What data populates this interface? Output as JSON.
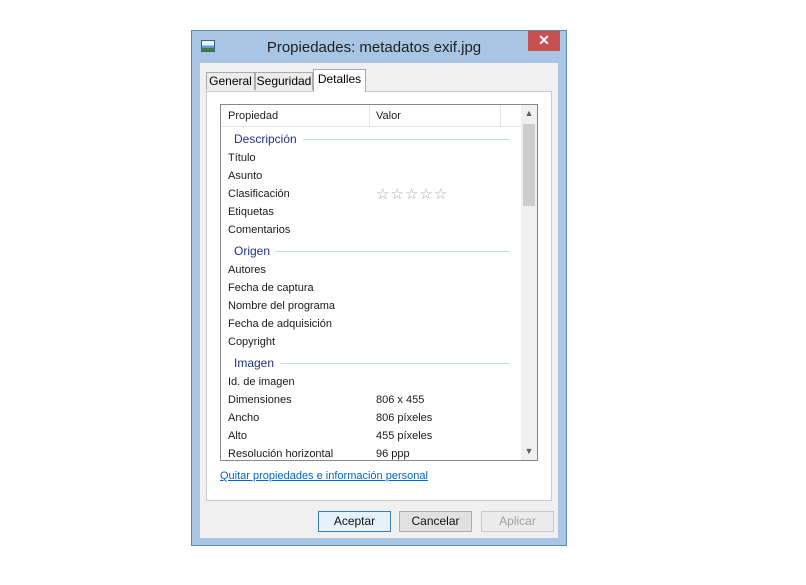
{
  "window": {
    "title": "Propiedades: metadatos exif.jpg",
    "close_glyph": "✕",
    "icon": "image-file-icon"
  },
  "tabs": [
    {
      "label": "General",
      "active": false
    },
    {
      "label": "Seguridad",
      "active": false
    },
    {
      "label": "Detalles",
      "active": true
    }
  ],
  "list": {
    "columns": {
      "property": "Propiedad",
      "value": "Valor"
    },
    "groups": [
      {
        "name": "Descripción",
        "rows": [
          {
            "property": "Título",
            "value": ""
          },
          {
            "property": "Asunto",
            "value": ""
          },
          {
            "property": "Clasificación",
            "value": "",
            "stars": 5
          },
          {
            "property": "Etiquetas",
            "value": ""
          },
          {
            "property": "Comentarios",
            "value": ""
          }
        ]
      },
      {
        "name": "Origen",
        "rows": [
          {
            "property": "Autores",
            "value": ""
          },
          {
            "property": "Fecha de captura",
            "value": ""
          },
          {
            "property": "Nombre del programa",
            "value": ""
          },
          {
            "property": "Fecha de adquisición",
            "value": ""
          },
          {
            "property": "Copyright",
            "value": ""
          }
        ]
      },
      {
        "name": "Imagen",
        "rows": [
          {
            "property": "Id. de imagen",
            "value": ""
          },
          {
            "property": "Dimensiones",
            "value": "806 x 455"
          },
          {
            "property": "Ancho",
            "value": "806 píxeles"
          },
          {
            "property": "Alto",
            "value": "455 píxeles"
          },
          {
            "property": "Resolución horizontal",
            "value": "96 ppp"
          }
        ]
      }
    ],
    "star_glyph": "☆"
  },
  "link_text": "Quitar propiedades e información personal",
  "buttons": {
    "accept": "Aceptar",
    "cancel": "Cancelar",
    "apply": "Aplicar"
  },
  "colors": {
    "frame": "#a8c6e3",
    "close": "#c75050",
    "group_text": "#1e3287",
    "link": "#0066cc"
  }
}
